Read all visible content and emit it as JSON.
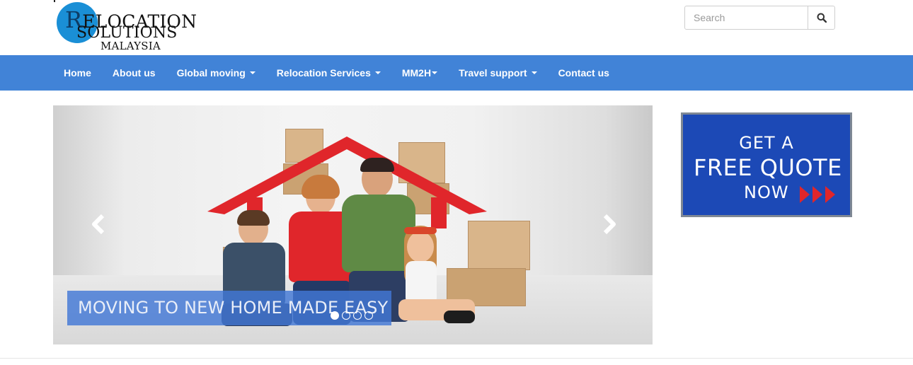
{
  "logo": {
    "line1_initial": "R",
    "line1_rest": "ELOCATION",
    "line2": "SOLUTIONS",
    "line3": "MALAYSIA"
  },
  "search": {
    "placeholder": "Search",
    "icon": "search-icon"
  },
  "nav": {
    "items": [
      {
        "label": "Home",
        "has_caret": false
      },
      {
        "label": "About us",
        "has_caret": false
      },
      {
        "label": "Global moving",
        "has_caret": true
      },
      {
        "label": "Relocation Services",
        "has_caret": true
      },
      {
        "label": "MM2H",
        "has_caret": true
      },
      {
        "label": "Travel support",
        "has_caret": true
      },
      {
        "label": "Contact us",
        "has_caret": false
      }
    ]
  },
  "carousel": {
    "caption": "MOVING TO NEW HOME MADE EASY",
    "prev_icon": "chevron-left-icon",
    "next_icon": "chevron-right-icon",
    "slide_count": 4,
    "active_slide": 1
  },
  "quote_banner": {
    "line1": "GET A",
    "line2": "FREE QUOTE",
    "line3": "NOW",
    "arrow_icon": "triple-arrow-icon"
  },
  "colors": {
    "nav_bg": "#4183d7",
    "caption_bg": "#4278d6",
    "quote_bg": "#1c49b6",
    "logo_blue": "#1a8fd6",
    "arrow_red": "#e0262b"
  }
}
